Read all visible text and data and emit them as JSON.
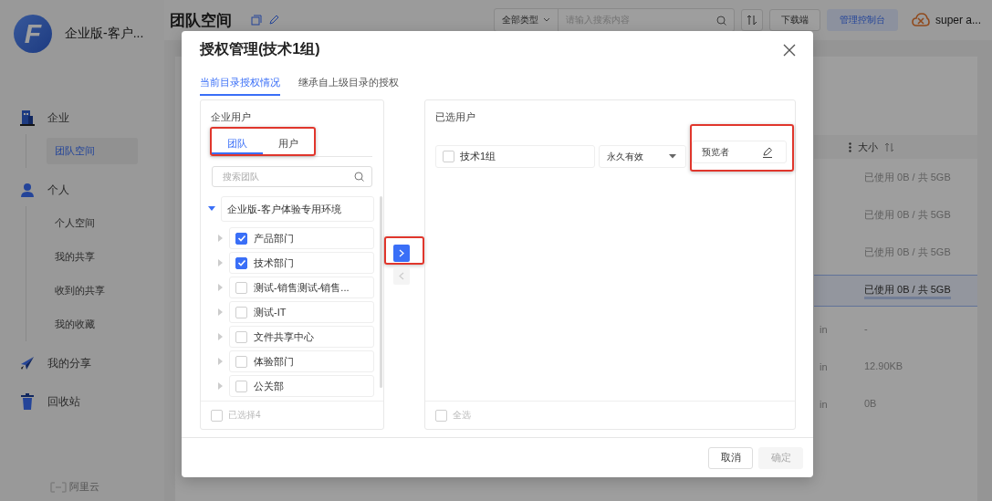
{
  "app": {
    "logo_letter": "F",
    "name": "企业版-客户...",
    "user": "super a..."
  },
  "toolbar": {
    "page_title": "团队空间",
    "type_filter": "全部类型",
    "search": {
      "placeholder": "请输入搜索内容"
    },
    "buttons": [
      {
        "label": "下载端",
        "kind": "plain"
      },
      {
        "label": "管理控制台",
        "kind": "primary"
      }
    ]
  },
  "sidebar": {
    "items": [
      {
        "label": "企业",
        "kind": "section",
        "selected": false
      },
      {
        "label": "团队空间",
        "kind": "sub",
        "selected": true
      },
      {
        "label": "个人",
        "kind": "section",
        "selected": false
      },
      {
        "label": "个人空间",
        "kind": "sub",
        "selected": false
      },
      {
        "label": "我的共享",
        "kind": "sub",
        "selected": false
      },
      {
        "label": "收到的共享",
        "kind": "sub",
        "selected": false
      },
      {
        "label": "我的收藏",
        "kind": "sub",
        "selected": false
      },
      {
        "label": "我的分享",
        "kind": "section",
        "selected": false
      },
      {
        "label": "回收站",
        "kind": "section",
        "selected": false
      }
    ],
    "footer": "阿里云"
  },
  "table": {
    "columns": [
      {
        "label": "大小"
      }
    ],
    "rows": [
      {
        "size": "已使用 0B / 共 5GB",
        "selected": false
      },
      {
        "size": "已使用 0B / 共 5GB",
        "selected": false
      },
      {
        "size": "已使用 0B / 共 5GB",
        "selected": false
      },
      {
        "size": "已使用 0B / 共 5GB",
        "selected": true
      },
      {
        "column_3": "in",
        "size": "-",
        "selected": false
      },
      {
        "column_3": "in",
        "size": "12.90KB",
        "selected": false
      },
      {
        "column_3": "in",
        "size": "0B",
        "selected": false
      }
    ]
  },
  "dialog": {
    "title": "授权管理(技术1组)",
    "tabs": [
      {
        "label": "当前目录授权情况",
        "selected": true
      },
      {
        "label": "继承自上级目录的授权",
        "selected": false
      }
    ],
    "source_panel": {
      "title": "企业用户",
      "highlighted": true,
      "tabs": [
        {
          "label": "团队",
          "selected": true
        },
        {
          "label": "用户",
          "selected": false
        }
      ],
      "search": {
        "placeholder": "搜索团队"
      },
      "tree": [
        {
          "label": "企业版-客户体验专用环境",
          "expanded": true,
          "children": [
            {
              "label": "产品部门",
              "checked": true,
              "expanded": false
            },
            {
              "label": "技术部门",
              "checked": true,
              "expanded": false
            },
            {
              "label": "测试-销售测试-销售...",
              "checked": false,
              "expanded": false
            },
            {
              "label": "测试-IT",
              "checked": false,
              "expanded": false
            },
            {
              "label": "文件共享中心",
              "checked": false,
              "expanded": false
            },
            {
              "label": "体验部门",
              "checked": false,
              "expanded": false
            },
            {
              "label": "公关部",
              "checked": false,
              "expanded": false
            }
          ]
        }
      ],
      "footer": {
        "label": "已选择4",
        "checked": false
      }
    },
    "transfer": {
      "buttons": [
        {
          "kind": "right",
          "disabled": false,
          "highlighted": true
        },
        {
          "kind": "left",
          "disabled": true,
          "highlighted": false
        }
      ]
    },
    "target_panel": {
      "title": "已选用户",
      "rows": [
        {
          "name": "技术1组",
          "checked": false,
          "validity": "永久有效",
          "role": "预览者",
          "role_highlighted": true
        }
      ],
      "footer": {
        "label": "全选",
        "checked": false
      }
    },
    "buttons": [
      {
        "label": "取消",
        "disabled": false
      },
      {
        "label": "确定",
        "disabled": true
      }
    ]
  }
}
